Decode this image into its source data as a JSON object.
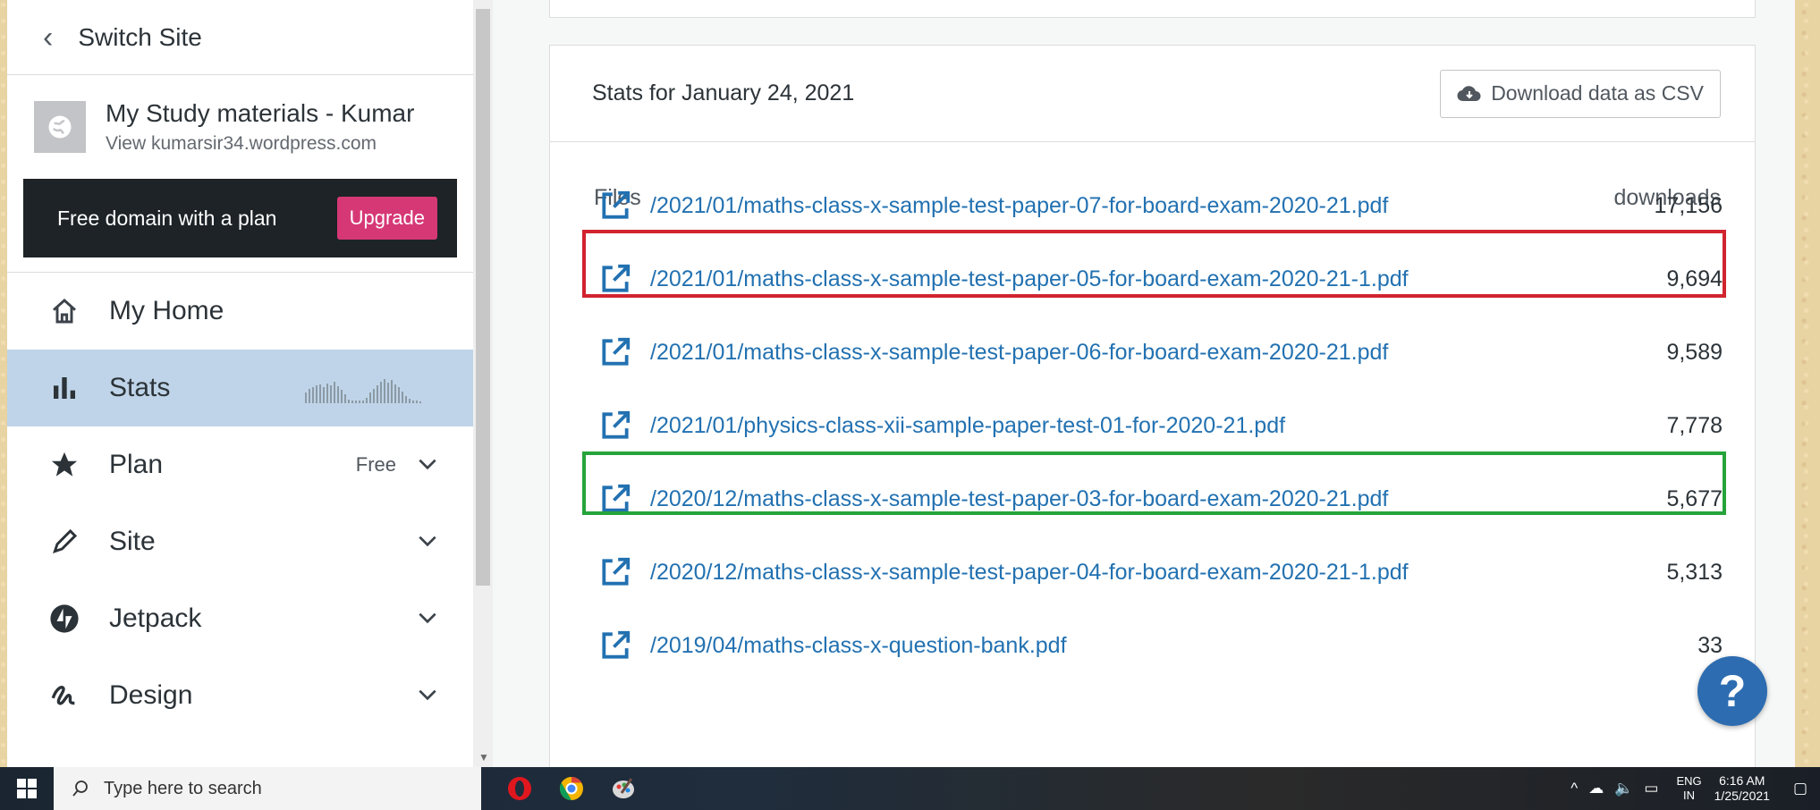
{
  "sidebar": {
    "switch_site": "Switch Site",
    "site_name": "My Study materials - Kumar",
    "site_url": "View kumarsir34.wordpress.com",
    "promo_text": "Free domain with a plan",
    "upgrade_label": "Upgrade",
    "items": [
      {
        "label": "My Home",
        "icon": "home-icon"
      },
      {
        "label": "Stats",
        "icon": "stats-icon",
        "active": true
      },
      {
        "label": "Plan",
        "icon": "star-icon",
        "tag": "Free"
      },
      {
        "label": "Site",
        "icon": "pencil-icon"
      },
      {
        "label": "Jetpack",
        "icon": "jetpack-icon"
      },
      {
        "label": "Design",
        "icon": "design-icon"
      }
    ]
  },
  "stats": {
    "title": "Stats for January 24, 2021",
    "csv_label": "Download data as CSV",
    "col_files": "Files",
    "col_downloads": "downloads",
    "rows": [
      {
        "file": "/2021/01/maths-class-x-sample-test-paper-07-for-board-exam-2020-21.pdf",
        "downloads": "17,156"
      },
      {
        "file": "/2021/01/maths-class-x-sample-test-paper-05-for-board-exam-2020-21-1.pdf",
        "downloads": "9,694"
      },
      {
        "file": "/2021/01/maths-class-x-sample-test-paper-06-for-board-exam-2020-21.pdf",
        "downloads": "9,589"
      },
      {
        "file": "/2021/01/physics-class-xii-sample-paper-test-01-for-2020-21.pdf",
        "downloads": "7,778"
      },
      {
        "file": "/2020/12/maths-class-x-sample-test-paper-03-for-board-exam-2020-21.pdf",
        "downloads": "5,677"
      },
      {
        "file": "/2020/12/maths-class-x-sample-test-paper-04-for-board-exam-2020-21-1.pdf",
        "downloads": "5,313"
      },
      {
        "file": "/2019/04/maths-class-x-question-bank.pdf",
        "downloads": "33"
      }
    ]
  },
  "help_label": "?",
  "taskbar": {
    "search_placeholder": "Type here to search",
    "lang_top": "ENG",
    "lang_bottom": "IN",
    "time": "6:16 AM",
    "date": "1/25/2021"
  },
  "colors": {
    "link": "#2271b1",
    "upgrade": "#d63876",
    "active_nav": "#bfd4e8",
    "highlight_red": "#d1242f",
    "highlight_green": "#26a43b"
  }
}
